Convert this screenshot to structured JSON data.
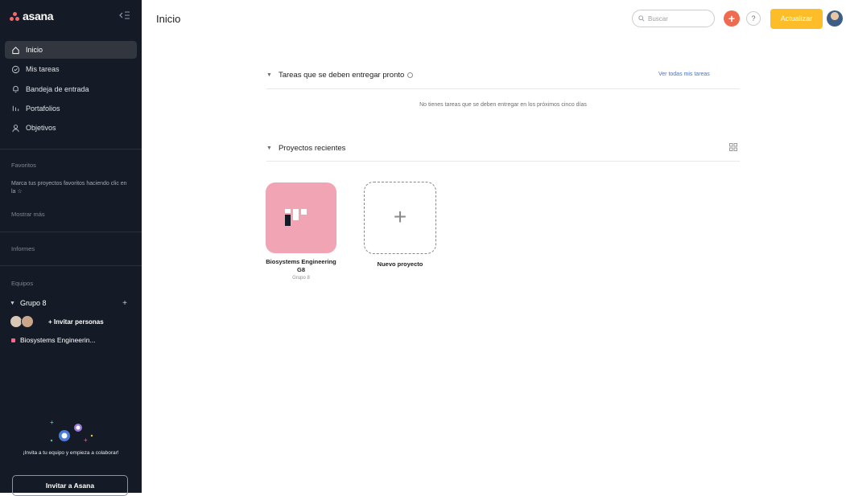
{
  "app": {
    "brand": "asana"
  },
  "sidebar": {
    "nav": [
      {
        "label": "Inicio",
        "icon": "home-icon",
        "active": true
      },
      {
        "label": "Mis tareas",
        "icon": "check-circle-icon",
        "active": false
      },
      {
        "label": "Bandeja de entrada",
        "icon": "bell-icon",
        "active": false
      },
      {
        "label": "Portafolios",
        "icon": "bar-chart-icon",
        "active": false
      },
      {
        "label": "Objetivos",
        "icon": "person-icon",
        "active": false
      }
    ],
    "favorites": {
      "title": "Favoritos",
      "hint": "Marca tus proyectos favoritos haciendo clic en la ☆",
      "show_more": "Mostrar más"
    },
    "reports": {
      "title": "Informes"
    },
    "teams": {
      "title": "Equipos",
      "team_name": "Grupo 8",
      "invite_people": "+ Invitar personas",
      "project": "Biosystems Engineerin..."
    },
    "invite_text": "¡Invita a tu equipo y empieza a colaborar!",
    "invite_button": "Invitar a Asana"
  },
  "header": {
    "title": "Inicio",
    "search_placeholder": "Buscar",
    "help_label": "?",
    "upgrade_label": "Actualizar"
  },
  "tasks": {
    "title": "Tareas que se deben entregar pronto",
    "see_all": "Ver todas mis tareas",
    "empty": "No tienes tareas que se deben entregar en los próximos cinco días"
  },
  "projects": {
    "title": "Proyectos recientes",
    "items": [
      {
        "name": "Biosystems Engineering G8",
        "team": "Grupo 8",
        "color": "#f1a4b3"
      }
    ],
    "new_label": "Nuevo proyecto"
  },
  "colors": {
    "sidebar_bg": "#151b26",
    "accent_orange": "#f06a4f",
    "upgrade_yellow": "#fcbd28",
    "project_pink": "#f1a4b3",
    "link_blue": "#4573d2"
  }
}
